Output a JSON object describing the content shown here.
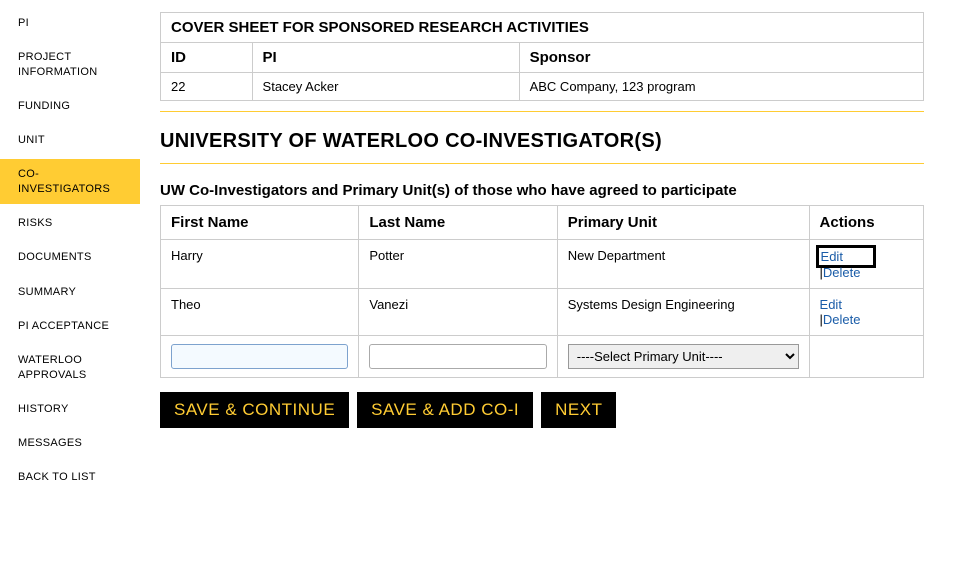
{
  "sidebar": {
    "items": [
      {
        "label": "PI"
      },
      {
        "label": "PROJECT INFORMATION"
      },
      {
        "label": "FUNDING"
      },
      {
        "label": "UNIT"
      },
      {
        "label": "CO-INVESTIGATORS",
        "active": true
      },
      {
        "label": "RISKS"
      },
      {
        "label": "DOCUMENTS"
      },
      {
        "label": "SUMMARY"
      },
      {
        "label": "PI ACCEPTANCE"
      },
      {
        "label": "WATERLOO APPROVALS"
      },
      {
        "label": "HISTORY"
      },
      {
        "label": "MESSAGES"
      },
      {
        "label": "BACK TO LIST"
      }
    ]
  },
  "cover": {
    "title": "COVER SHEET FOR SPONSORED RESEARCH ACTIVITIES",
    "headers": {
      "id": "ID",
      "pi": "PI",
      "sponsor": "Sponsor"
    },
    "row": {
      "id": "22",
      "pi": "Stacey Acker",
      "sponsor": "ABC Company, 123 program"
    }
  },
  "section": {
    "title": "UNIVERSITY OF WATERLOO CO-INVESTIGATOR(S)",
    "subtitle": "UW Co-Investigators and Primary Unit(s) of those who have agreed to participate"
  },
  "coi": {
    "headers": {
      "first": "First Name",
      "last": "Last Name",
      "unit": "Primary Unit",
      "actions": "Actions"
    },
    "rows": [
      {
        "first": "Harry",
        "last": "Potter",
        "unit": "New Department"
      },
      {
        "first": "Theo",
        "last": "Vanezi",
        "unit": "Systems Design Engineering"
      }
    ],
    "actions": {
      "edit": "Edit",
      "delete": "Delete"
    },
    "new": {
      "first": "",
      "last": "",
      "unit_placeholder": "----Select Primary Unit----"
    }
  },
  "buttons": {
    "save_continue": "SAVE & CONTINUE",
    "save_add": "SAVE & ADD CO-I",
    "next": "NEXT"
  }
}
